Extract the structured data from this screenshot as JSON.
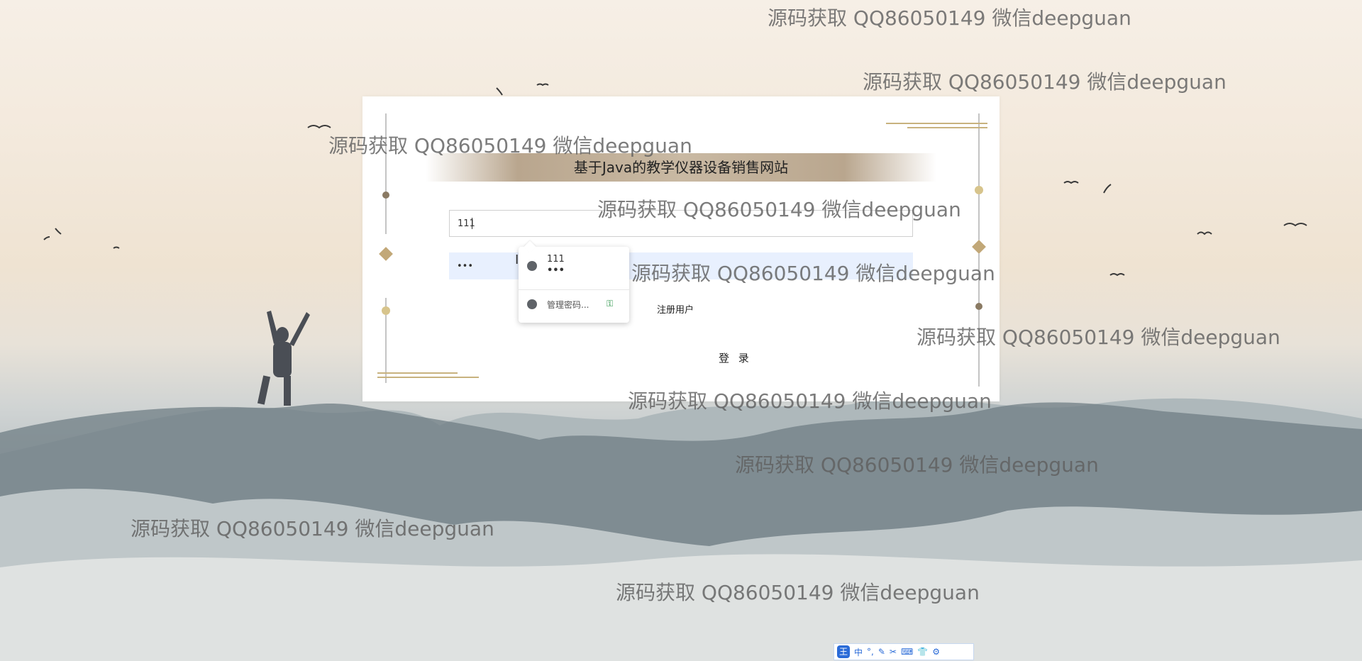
{
  "site_title": "基于Java的教学仪器设备销售网站",
  "form": {
    "username_value": "111",
    "password_value": "•••",
    "register_label": "注册用户",
    "login_label": "登 录"
  },
  "autofill": {
    "item_username": "111",
    "item_password": "•••",
    "manage_label": "管理密码...",
    "globe_icon": "globe-icon",
    "chrome_icon": "chrome-icon",
    "key_icon": "key-icon",
    "key_glyph": "⚿"
  },
  "watermark_text": "源码获取 QQ86050149 微信deepguan",
  "ime_toolbar": {
    "logo": "王",
    "items": [
      "中",
      "°,",
      "✎",
      "✂",
      "⌨",
      "👕",
      "⚙"
    ]
  },
  "colors": {
    "accent_gold": "#c8b27e",
    "title_band": "#bfae97",
    "autofill_bg": "#e8f0fe",
    "ime_blue": "#2a6bd8"
  }
}
